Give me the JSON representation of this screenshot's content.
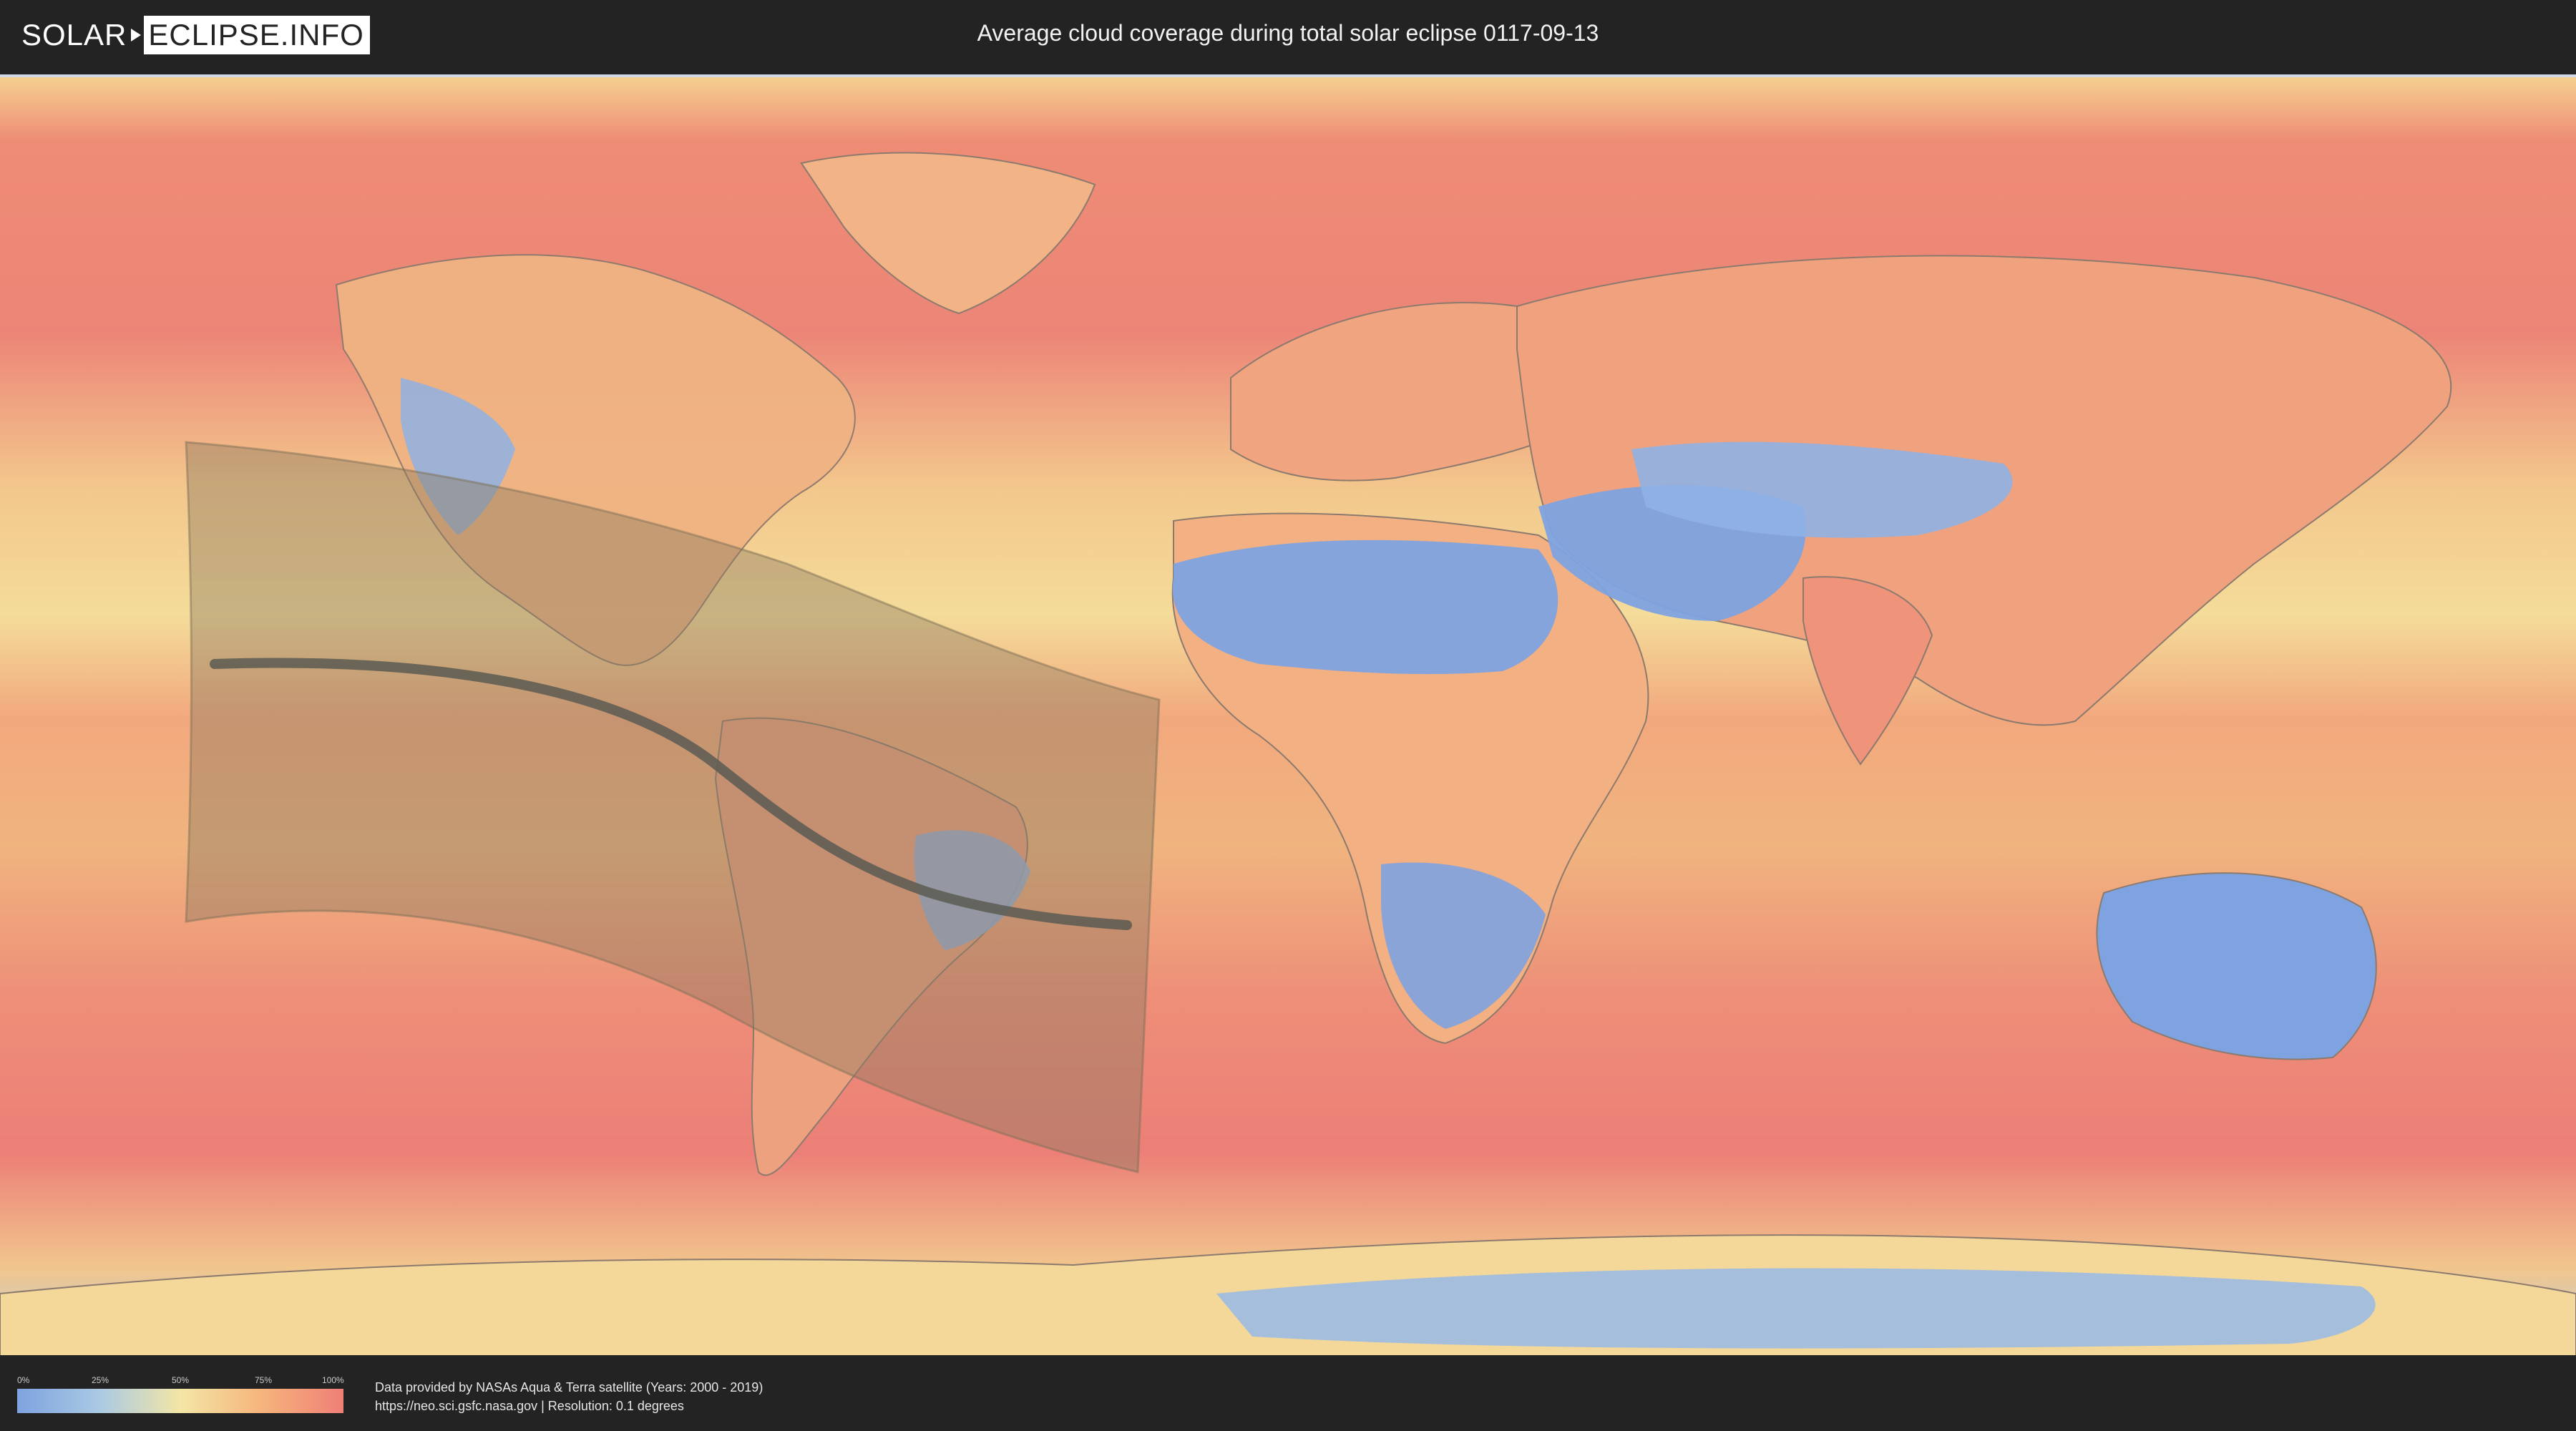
{
  "header": {
    "logo_left": "SOLAR",
    "logo_right": "ECLIPSE.INFO",
    "title": "Average cloud coverage during total solar eclipse 0117-09-13"
  },
  "map": {
    "layer": "average cloud coverage",
    "eclipse_type": "total solar eclipse",
    "eclipse_date": "0117-09-13",
    "colors": {
      "clear": "#7ea3e0",
      "low": "#a9c9e4",
      "mid": "#f3e6a6",
      "high": "#f6b47c",
      "overcast": "#ef7f76",
      "shadow_band": "#8a7a5f",
      "central_line": "#5a5a52"
    }
  },
  "legend": {
    "ticks": [
      "0%",
      "25%",
      "50%",
      "75%",
      "100%"
    ]
  },
  "footer": {
    "credit_line1": "Data provided by NASAs Aqua & Terra satellite (Years: 2000 - 2019)",
    "credit_line2": "https://neo.sci.gsfc.nasa.gov | Resolution: 0.1 degrees"
  }
}
